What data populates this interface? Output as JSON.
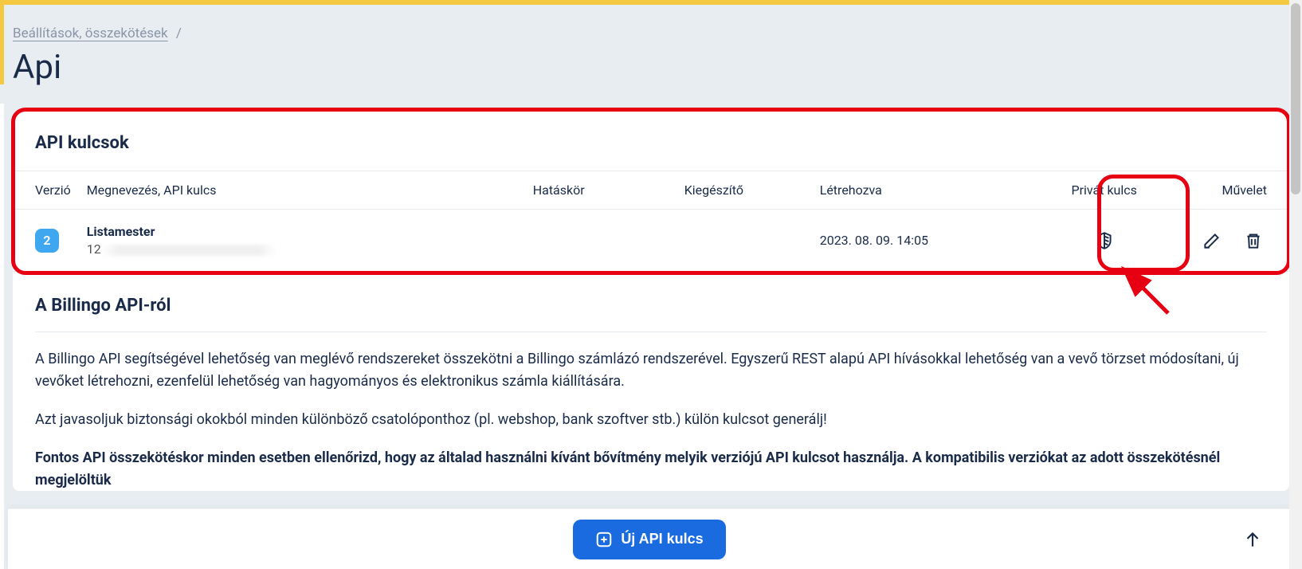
{
  "breadcrumb": {
    "link": "Beállítások, összekötések",
    "sep": "/"
  },
  "page_title": "Api",
  "api_keys": {
    "heading": "API kulcsok",
    "columns": {
      "version": "Verzió",
      "name": "Megnevezés, API kulcs",
      "scope": "Hatáskör",
      "addon": "Kiegészítő",
      "created": "Létrehozva",
      "private": "Privát kulcs",
      "action": "Művelet"
    },
    "rows": [
      {
        "version": "2",
        "name": "Listamester",
        "key_prefix": "12",
        "scope": "",
        "addon": "",
        "created": "2023. 08. 09. 14:05"
      }
    ]
  },
  "about": {
    "heading": "A Billingo API-ról",
    "p1": "A Billingo API segítségével lehetőség van meglévő rendszereket összekötni a Billingo számlázó rendszerével. Egyszerű REST alapú API hívásokkal lehetőség van a vevő törzset módosítani, új vevőket létrehozni, ezenfelül lehetőség van hagyományos és elektronikus számla kiállítására.",
    "p2": "Azt javasoljuk biztonsági okokból minden különböző csatolóponthoz (pl. webshop, bank szoftver stb.) külön kulcsot generálj!",
    "p3": "Fontos API összekötéskor minden esetben ellenőrizd, hogy az általad használni kívánt bővítmény melyik verziójú API kulcsot használja. A kompatibilis verziókat az adott összekötésnél megjelöltük"
  },
  "bottom": {
    "new_key": "Új API kulcs"
  }
}
